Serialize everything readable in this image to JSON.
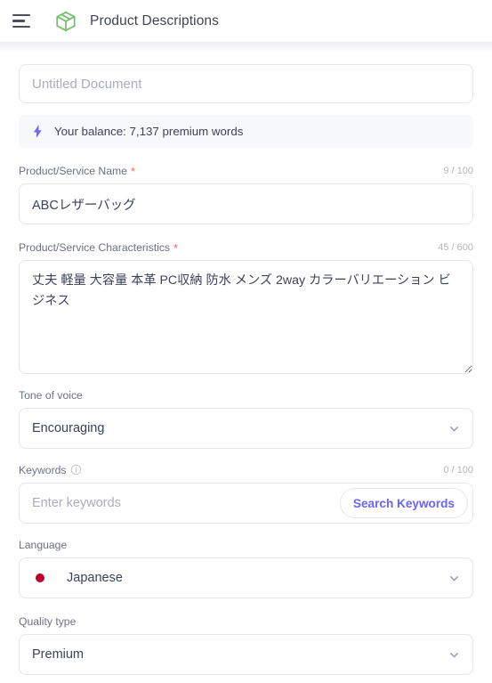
{
  "header": {
    "menu_icon": "hamburger-menu-icon",
    "app_icon": "green-box-cube-icon",
    "title": "Product Descriptions"
  },
  "document": {
    "title_value": "",
    "title_placeholder": "Untitled Document"
  },
  "balance": {
    "icon": "lightning-bolt-icon",
    "text": "Your balance: 7,137 premium words",
    "icon_color": "#6c63ff",
    "background": "#f7f8fa"
  },
  "form": {
    "product_name": {
      "label": "Product/Service Name",
      "required_marker": "*",
      "counter": "9 / 100",
      "value": "ABCレザーバッグ",
      "placeholder": ""
    },
    "characteristics": {
      "label": "Product/Service Characteristics",
      "required_marker": "*",
      "counter": "45 / 600",
      "value": "丈夫 軽量 大容量 本革 PC収納 防水 メンズ 2way カラーバリエーション ビジネス",
      "placeholder": ""
    },
    "tone_of_voice": {
      "label": "Tone of voice",
      "value": "Encouraging",
      "chevron_icon": "chevron-down-icon"
    },
    "keywords": {
      "label": "Keywords",
      "info_icon": "info-circle-icon",
      "counter": "0 / 100",
      "value": "",
      "placeholder": "Enter keywords",
      "button_label": "Search Keywords",
      "button_color": "#6c63ff"
    },
    "language": {
      "label": "Language",
      "value": "Japanese",
      "flag_icon": "japan-flag-icon",
      "flag_color": "#bc002d",
      "chevron_icon": "chevron-down-icon"
    },
    "quality_type": {
      "label": "Quality type",
      "value": "Premium",
      "chevron_icon": "chevron-down-icon"
    }
  },
  "theme": {
    "accent": "#6c63ff",
    "brand_green": "#72bf6a",
    "required_red": "#ef6b5e",
    "border": "#e5e6ec",
    "label_gray": "#6b7183"
  }
}
